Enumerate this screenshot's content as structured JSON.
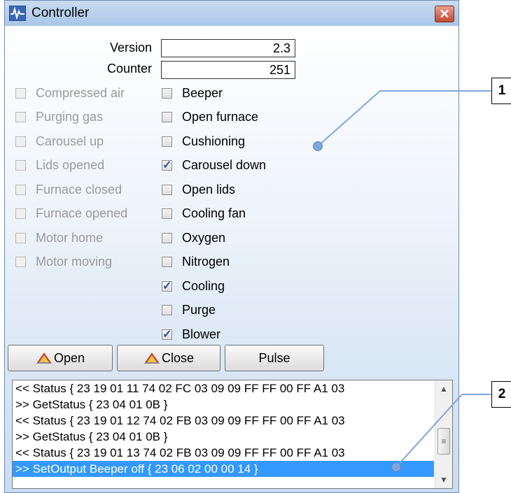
{
  "window": {
    "title": "Controller",
    "close_glyph": "✕"
  },
  "fields": {
    "version_label": "Version",
    "version_value": "2.3",
    "counter_label": "Counter",
    "counter_value": "251"
  },
  "inputs_left": [
    {
      "label": "Compressed air",
      "checked": false
    },
    {
      "label": "Purging gas",
      "checked": false
    },
    {
      "label": "Carousel up",
      "checked": false
    },
    {
      "label": "Lids opened",
      "checked": false
    },
    {
      "label": "Furnace closed",
      "checked": false
    },
    {
      "label": "Furnace opened",
      "checked": false
    },
    {
      "label": "Motor home",
      "checked": false
    },
    {
      "label": "Motor moving",
      "checked": false
    }
  ],
  "outputs_right": [
    {
      "label": "Beeper",
      "checked": false
    },
    {
      "label": "Open furnace",
      "checked": false
    },
    {
      "label": "Cushioning",
      "checked": false
    },
    {
      "label": "Carousel down",
      "checked": true
    },
    {
      "label": "Open lids",
      "checked": false
    },
    {
      "label": "Cooling fan",
      "checked": false
    },
    {
      "label": "Oxygen",
      "checked": false
    },
    {
      "label": "Nitrogen",
      "checked": false
    },
    {
      "label": "Cooling",
      "checked": true
    },
    {
      "label": "Purge",
      "checked": false
    },
    {
      "label": "Blower",
      "checked": true
    }
  ],
  "buttons": {
    "open": "Open",
    "close": "Close",
    "pulse": "Pulse"
  },
  "log": [
    "<< Status { 23 19 01 11 74 02 FC 03 09 09 FF FF 00 FF A1 03",
    ">> GetStatus { 23 04 01 0B }",
    "<< Status { 23 19 01 12 74 02 FB 03 09 09 FF FF 00 FF A1 03",
    ">> GetStatus { 23 04 01 0B }",
    "<< Status { 23 19 01 13 74 02 FB 03 09 09 FF FF 00 FF A1 03",
    ">> SetOutput Beeper off { 23 06 02 00 00 14 }"
  ],
  "callouts": [
    "1",
    "2"
  ],
  "colors": {
    "accent": "#3399ff",
    "callout_line": "#7ea7dc"
  }
}
